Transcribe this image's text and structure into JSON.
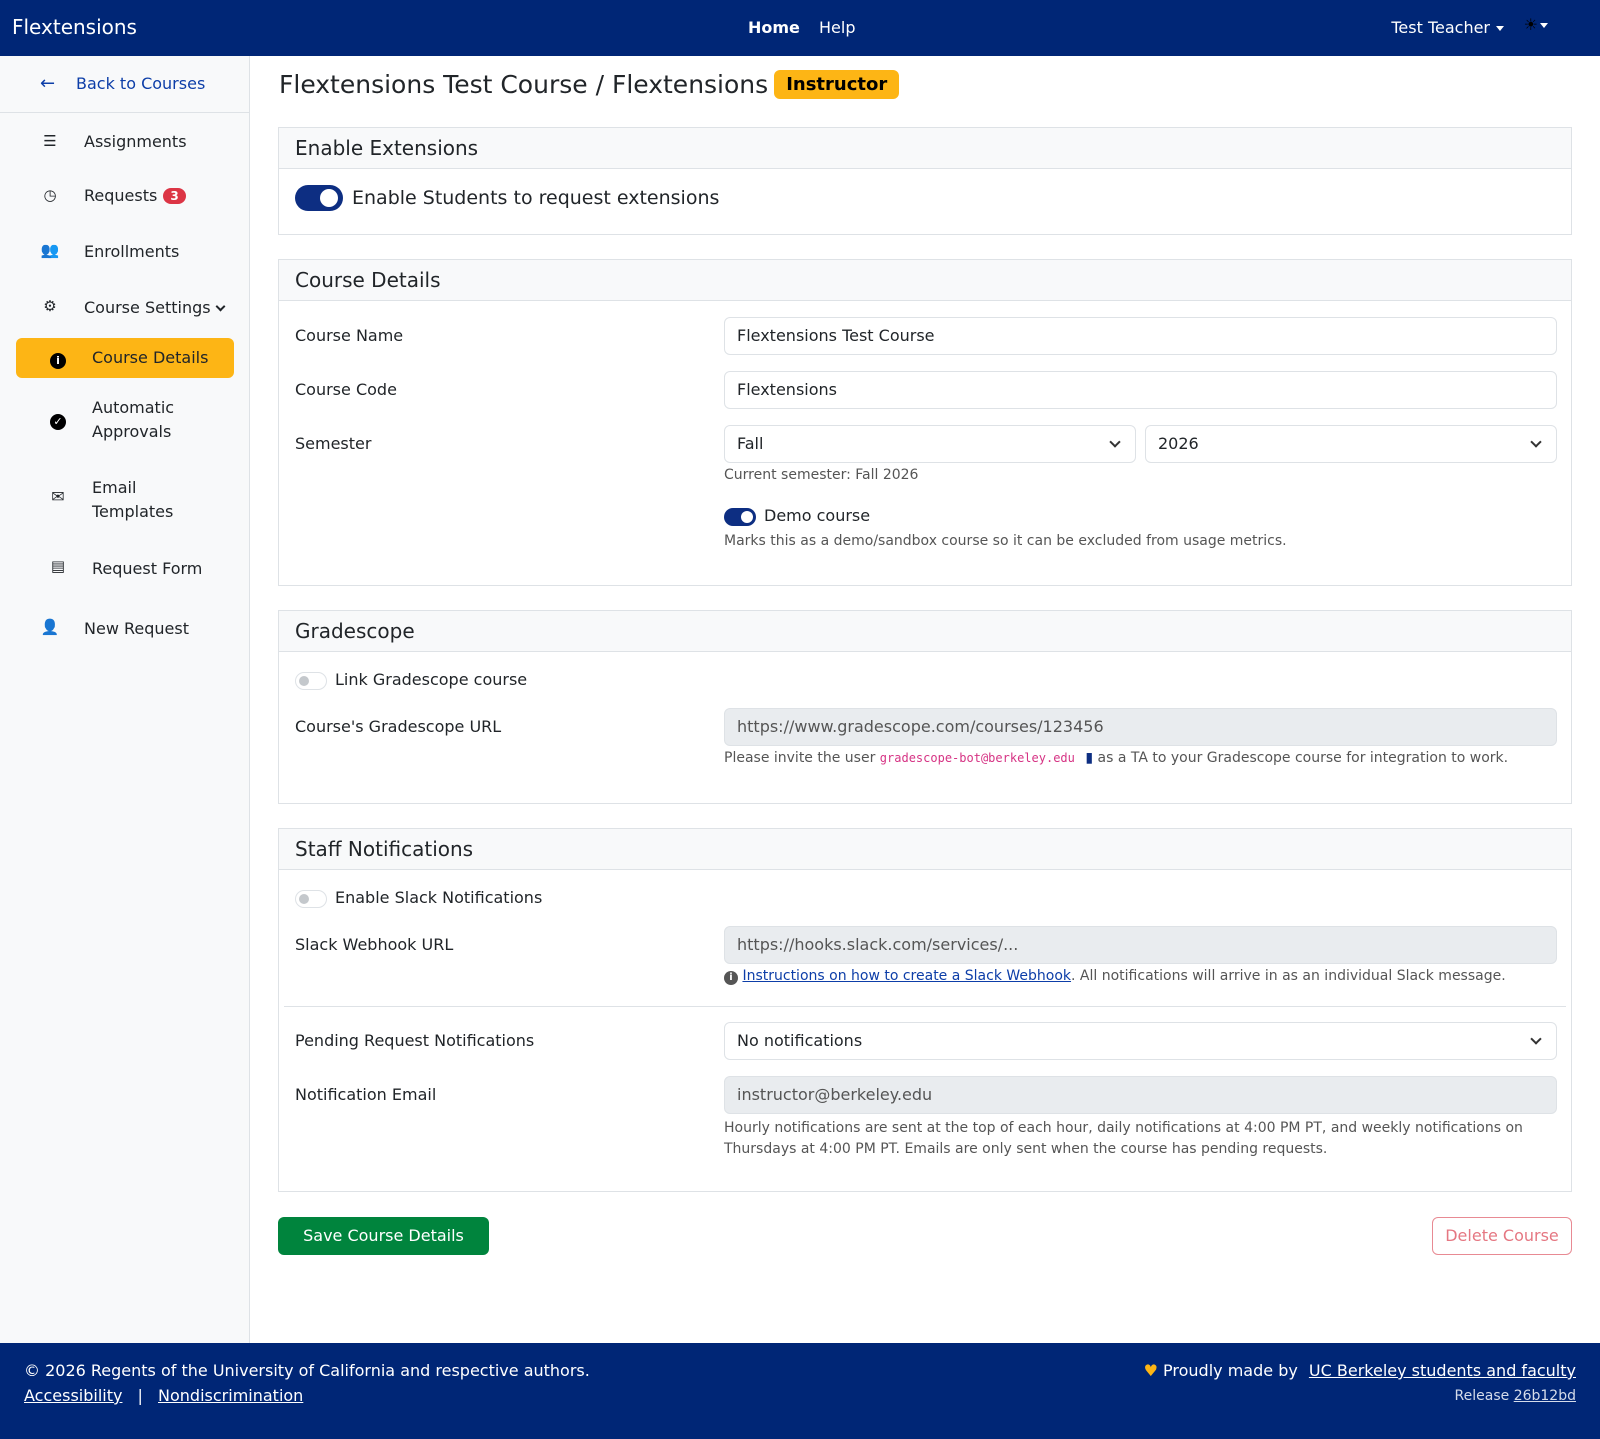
{
  "navbar": {
    "brand": "Flextensions",
    "links": [
      "Home",
      "Help"
    ],
    "user": "Test Teacher",
    "theme_icon": "sun-icon"
  },
  "sidebar": {
    "back": "Back to Courses",
    "items": [
      {
        "label": "Assignments",
        "icon": "list-check-icon"
      },
      {
        "label": "Requests",
        "icon": "clock-icon",
        "badge": "3"
      },
      {
        "label": "Enrollments",
        "icon": "users-icon"
      },
      {
        "label": "Course Settings",
        "icon": "gear-icon"
      }
    ],
    "sub_items": [
      {
        "label": "Course Details",
        "icon": "info-circle-icon",
        "active": true
      },
      {
        "label": "Automatic Approvals",
        "icon": "check-circle-icon"
      },
      {
        "label": "Email Templates",
        "icon": "envelope-icon"
      },
      {
        "label": "Request Form",
        "icon": "file-icon"
      }
    ],
    "new_request": "New Request"
  },
  "page": {
    "title": "Flextensions Test Course / Flextensions",
    "role_badge": "Instructor"
  },
  "enable_extensions": {
    "header": "Enable Extensions",
    "toggle_label": "Enable Students to request extensions",
    "enabled": true
  },
  "course_details": {
    "header": "Course Details",
    "name_label": "Course Name",
    "name_value": "Flextensions Test Course",
    "code_label": "Course Code",
    "code_value": "Flextensions",
    "semester_label": "Semester",
    "term_value": "Fall",
    "year_value": "2026",
    "current_semester": "Current semester: Fall 2026",
    "demo_label": "Demo course",
    "demo_enabled": true,
    "demo_help": "Marks this as a demo/sandbox course so it can be excluded from usage metrics."
  },
  "gradescope": {
    "header": "Gradescope",
    "link_label": "Link Gradescope course",
    "link_enabled": false,
    "url_label": "Course's Gradescope URL",
    "url_placeholder": "https://www.gradescope.com/courses/123456",
    "help_prefix": "Please invite the user",
    "bot_email": "gradescope-bot@berkeley.edu",
    "help_suffix": "as a TA to your Gradescope course for integration to work."
  },
  "staff_notifications": {
    "header": "Staff Notifications",
    "slack_label": "Enable Slack Notifications",
    "slack_enabled": false,
    "webhook_label": "Slack Webhook URL",
    "webhook_placeholder": "https://hooks.slack.com/services/...",
    "webhook_link": "Instructions on how to create a Slack Webhook",
    "webhook_help": ". All notifications will arrive in as an individual Slack message.",
    "pending_label": "Pending Request Notifications",
    "pending_value": "No notifications",
    "email_label": "Notification Email",
    "email_value": "instructor@berkeley.edu",
    "email_help": "Hourly notifications are sent at the top of each hour, daily notifications at 4:00 PM PT, and weekly notifications on Thursdays at 4:00 PM PT. Emails are only sent when the course has pending requests."
  },
  "actions": {
    "save": "Save Course Details",
    "delete": "Delete Course"
  },
  "footer": {
    "copyright": "© 2026 Regents of the University of California and respective authors.",
    "accessibility": "Accessibility",
    "separator": "|",
    "nondiscrimination": "Nondiscrimination",
    "made_by_prefix": "Proudly made by",
    "made_by_link": "UC Berkeley students and faculty",
    "release_label": "Release",
    "release_hash": "26b12bd"
  },
  "colors": {
    "navy": "#002676",
    "gold": "#fdb515",
    "save_green": "#00843d",
    "delete_red": "#dc3545"
  }
}
